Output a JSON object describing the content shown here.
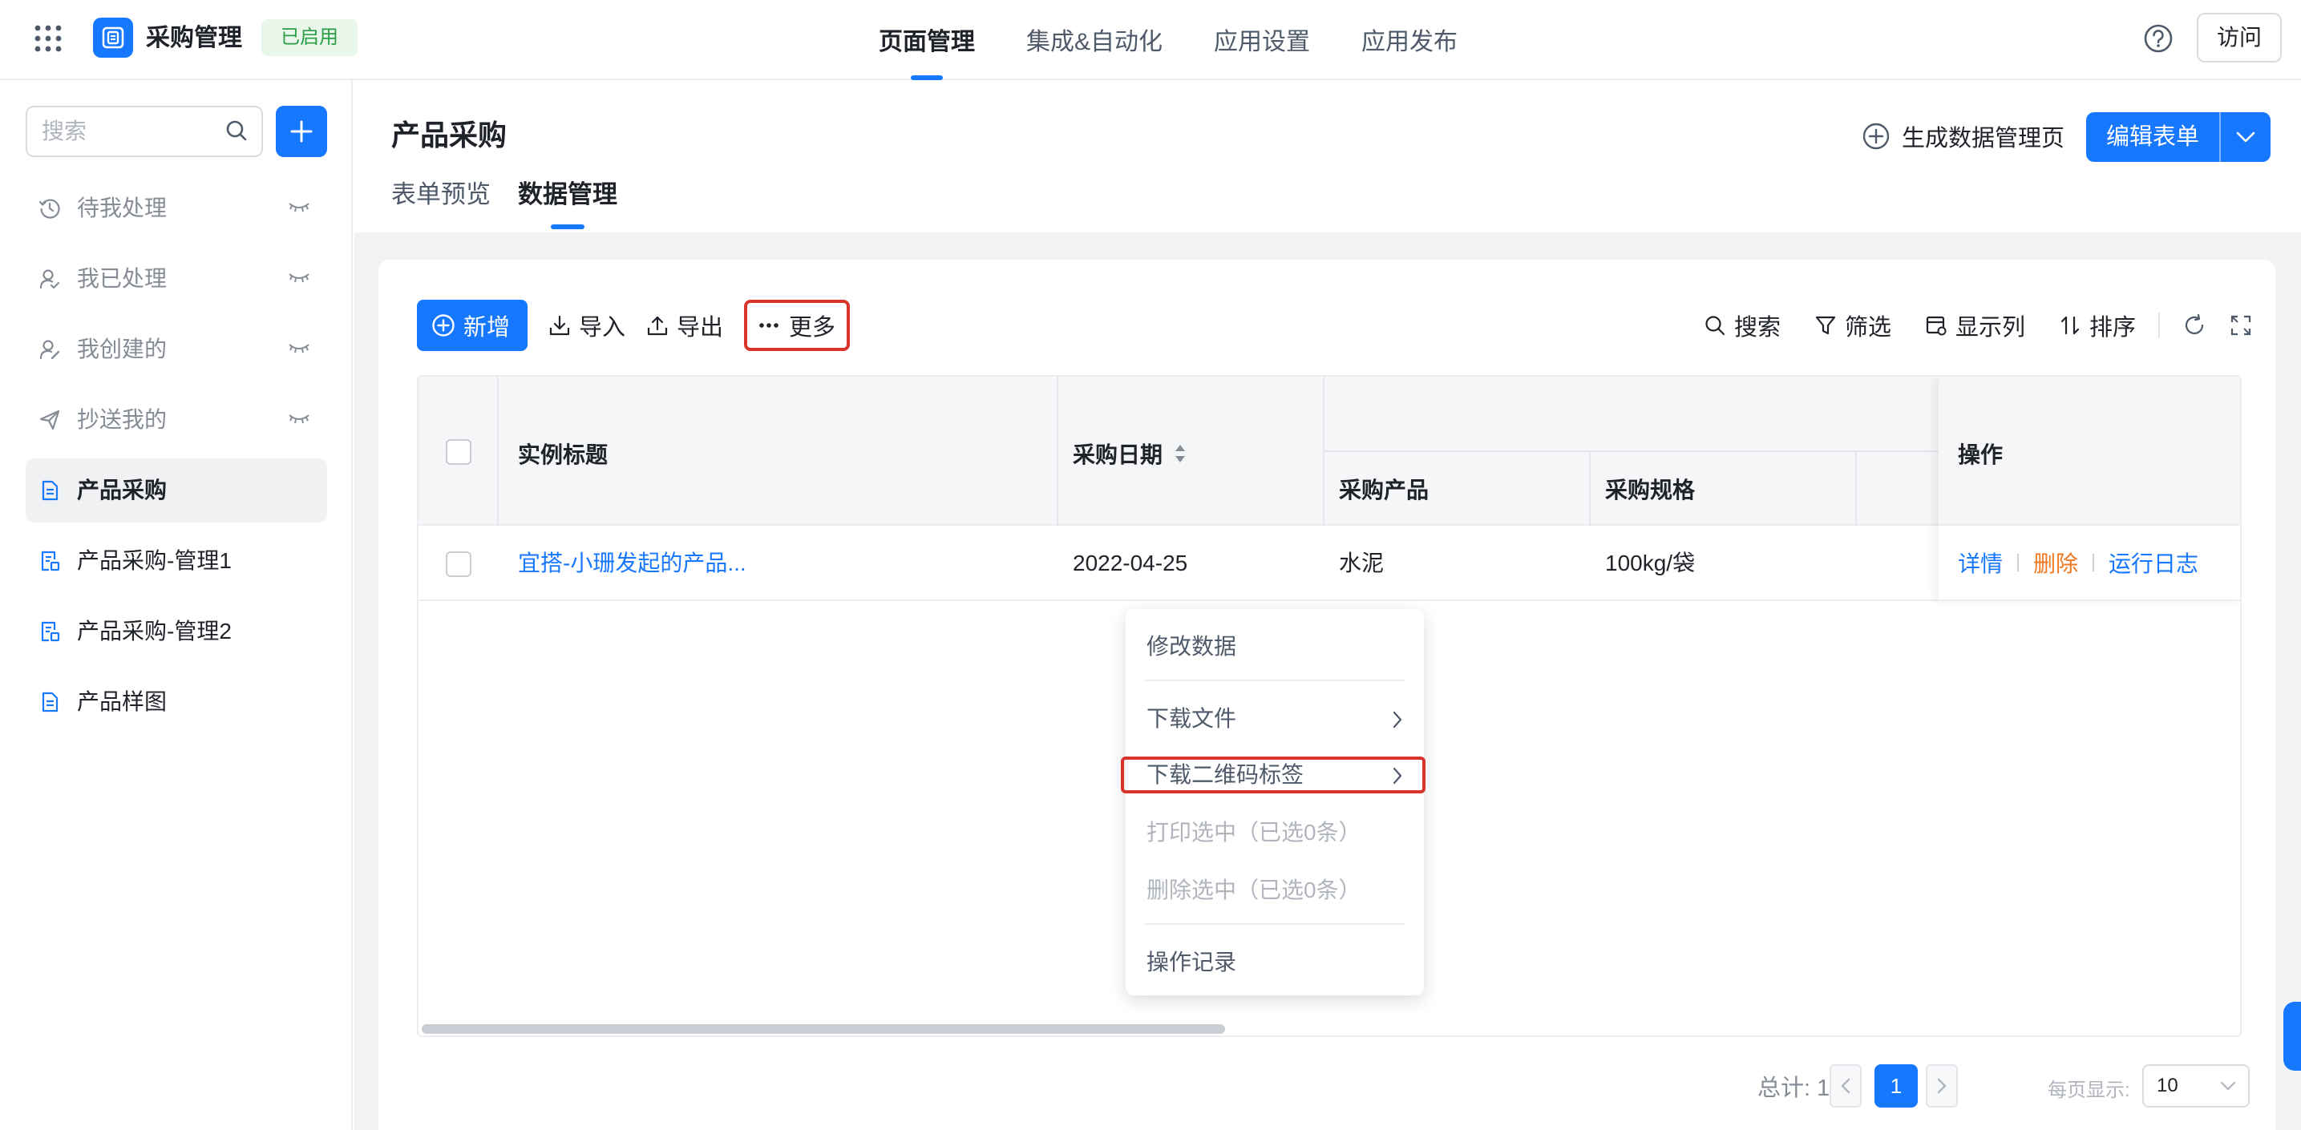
{
  "topbar": {
    "app_name": "采购管理",
    "status": "已启用",
    "nav": [
      {
        "label": "页面管理",
        "active": true
      },
      {
        "label": "集成&自动化",
        "active": false
      },
      {
        "label": "应用设置",
        "active": false
      },
      {
        "label": "应用发布",
        "active": false
      }
    ],
    "visit_label": "访问"
  },
  "sidebar": {
    "search_placeholder": "搜索",
    "items": [
      {
        "label": "待我处理",
        "icon": "clock-icon"
      },
      {
        "label": "我已处理",
        "icon": "user-check-icon"
      },
      {
        "label": "我创建的",
        "icon": "user-edit-icon"
      },
      {
        "label": "抄送我的",
        "icon": "send-icon"
      },
      {
        "label": "产品采购",
        "icon": "form-doc-icon",
        "active": true
      },
      {
        "label": "产品采购-管理1",
        "icon": "report-doc-icon"
      },
      {
        "label": "产品采购-管理2",
        "icon": "report-doc-icon"
      },
      {
        "label": "产品样图",
        "icon": "form-doc-icon"
      }
    ]
  },
  "header": {
    "title": "产品采购",
    "tabs": [
      {
        "label": "表单预览",
        "active": false
      },
      {
        "label": "数据管理",
        "active": true
      }
    ],
    "generate_label": "生成数据管理页",
    "edit_label": "编辑表单"
  },
  "toolbar": {
    "new_label": "新增",
    "import_label": "导入",
    "export_label": "导出",
    "more_label": "更多",
    "search_label": "搜索",
    "filter_label": "筛选",
    "columns_label": "显示列",
    "sort_label": "排序"
  },
  "table": {
    "headers": {
      "title": "实例标题",
      "date": "采购日期",
      "product": "采购产品",
      "spec": "采购规格",
      "ops": "操作"
    },
    "rows": [
      {
        "title": "宜搭-小珊发起的产品...",
        "date": "2022-04-25",
        "product": "水泥",
        "spec": "100kg/袋",
        "ops": {
          "detail": "详情",
          "delete": "删除",
          "log": "运行日志"
        }
      }
    ]
  },
  "more_menu": {
    "items": [
      {
        "label": "修改数据",
        "disabled": false
      },
      {
        "label": "下载文件",
        "disabled": false,
        "submenu": true
      },
      {
        "label": "下载二维码标签",
        "disabled": false,
        "submenu": true,
        "highlighted": true
      },
      {
        "label": "打印选中（已选0条）",
        "disabled": true
      },
      {
        "label": "删除选中（已选0条）",
        "disabled": true
      },
      {
        "label": "操作记录",
        "disabled": false
      }
    ]
  },
  "pagination": {
    "total": "总计: 1",
    "current_page": "1",
    "per_page_label": "每页显示:",
    "per_page_value": "10"
  },
  "colors": {
    "primary": "#1677ff",
    "danger_outline": "#d9342b",
    "delete_link": "#f0781e",
    "status_tag_bg": "#e8f7ea",
    "status_tag_text": "#2a9d45"
  }
}
